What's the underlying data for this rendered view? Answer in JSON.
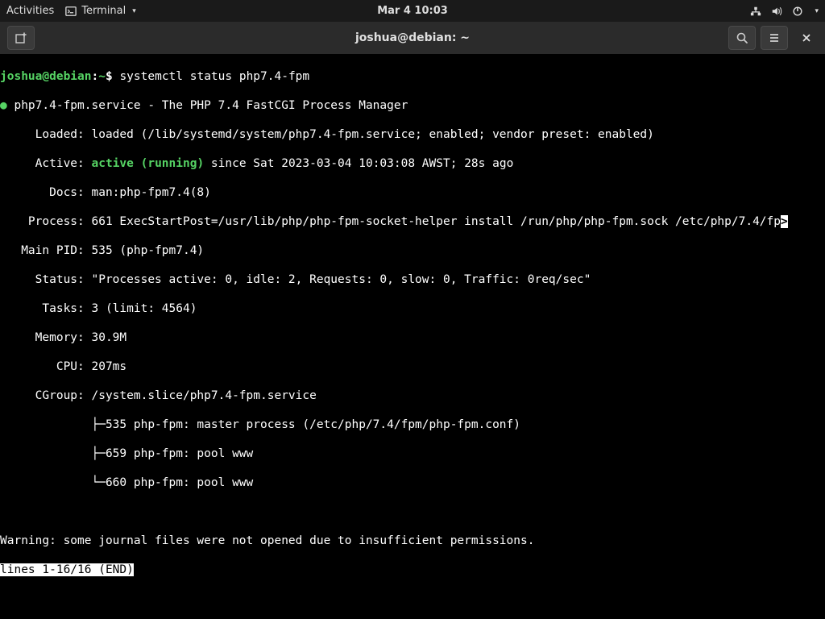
{
  "topbar": {
    "activities": "Activities",
    "app_name": "Terminal",
    "datetime": "Mar 4  10:03"
  },
  "titlebar": {
    "title": "joshua@debian: ~"
  },
  "prompt": {
    "userhost": "joshua@debian",
    "sep": ":",
    "path": "~",
    "dollar": "$ ",
    "command": "systemctl status php7.4-fpm"
  },
  "status": {
    "bullet": "●",
    "service_line": " php7.4-fpm.service - The PHP 7.4 FastCGI Process Manager",
    "loaded": "     Loaded: loaded (/lib/systemd/system/php7.4-fpm.service; enabled; vendor preset: enabled)",
    "active_prefix": "     Active: ",
    "active_value": "active (running)",
    "active_suffix": " since Sat 2023-03-04 10:03:08 AWST; 28s ago",
    "docs": "       Docs: man:php-fpm7.4(8)",
    "process": "    Process: 661 ExecStartPost=/usr/lib/php/php-fpm-socket-helper install /run/php/php-fpm.sock /etc/php/7.4/fp",
    "overflow": ">",
    "mainpid": "   Main PID: 535 (php-fpm7.4)",
    "statusln": "     Status: \"Processes active: 0, idle: 2, Requests: 0, slow: 0, Traffic: 0req/sec\"",
    "tasks": "      Tasks: 3 (limit: 4564)",
    "memory": "     Memory: 30.9M",
    "cpu": "        CPU: 207ms",
    "cgroup": "     CGroup: /system.slice/php7.4-fpm.service",
    "cg1": "             ├─535 php-fpm: master process (/etc/php/7.4/fpm/php-fpm.conf)",
    "cg2": "             ├─659 php-fpm: pool www",
    "cg3": "             └─660 php-fpm: pool www"
  },
  "warning": "Warning: some journal files were not opened due to insufficient permissions.",
  "pager": "lines 1-16/16 (END)"
}
